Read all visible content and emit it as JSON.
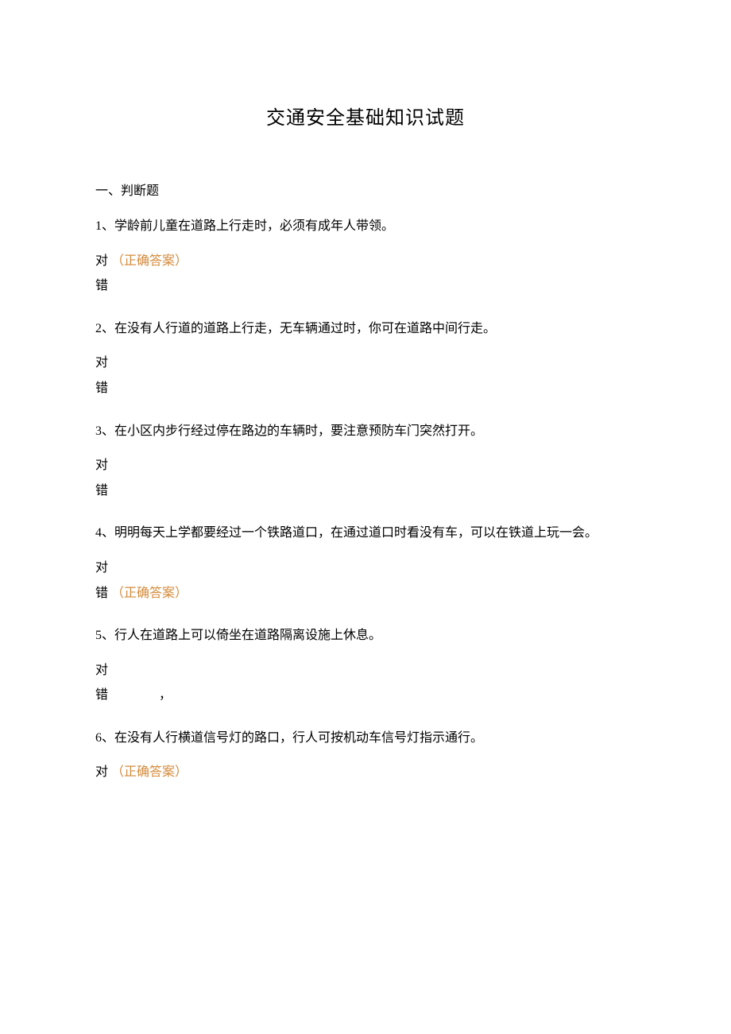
{
  "title": "交通安全基础知识试题",
  "section_header": "一、判断题",
  "correct_label": "（正确答案）",
  "choice_true": "对",
  "choice_false": "错",
  "questions": {
    "q1": {
      "text": "1、学龄前儿童在道路上行走时，必须有成年人带领。",
      "correct": "true"
    },
    "q2": {
      "text": "2、在没有人行道的道路上行走，无车辆通过时，你可在道路中间行走。",
      "correct": ""
    },
    "q3": {
      "text": "3、在小区内步行经过停在路边的车辆时，要注意预防车门突然打开。",
      "correct": ""
    },
    "q4": {
      "text": "4、明明每天上学都要经过一个铁路道口，在通过道口时看没有车，可以在铁道上玩一会。",
      "correct": "false"
    },
    "q5": {
      "text": "5、行人在道路上可以倚坐在道路隔离设施上休息。",
      "correct": "",
      "extra_mark": "，"
    },
    "q6": {
      "text": "6、在没有人行横道信号灯的路口，行人可按机动车信号灯指示通行。",
      "correct": "true"
    }
  }
}
